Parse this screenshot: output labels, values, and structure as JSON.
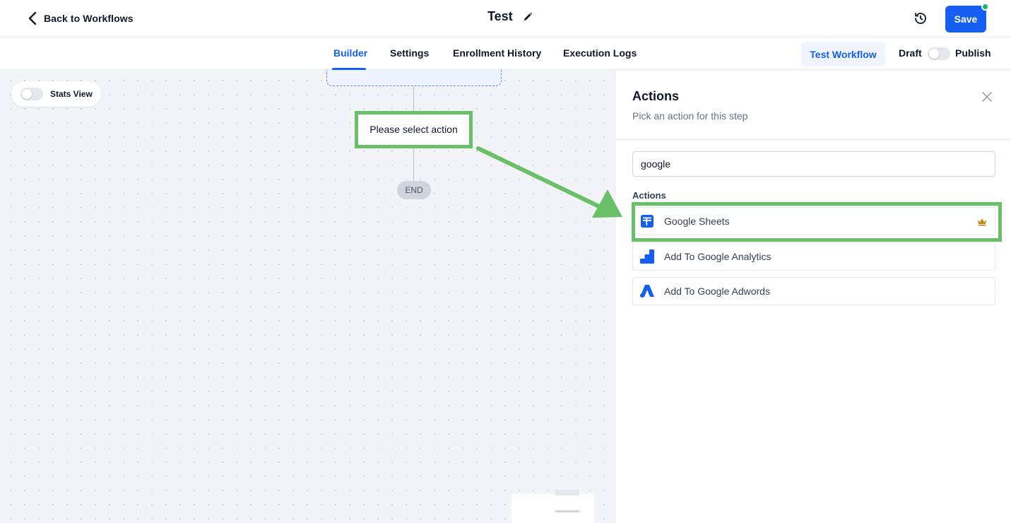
{
  "header": {
    "back_label": "Back to Workflows",
    "workflow_title": "Test",
    "save_label": "Save",
    "icons": {
      "back": "chevron-left-icon",
      "edit": "pencil-icon",
      "history": "history-clock-icon"
    },
    "status_dot_color": "#12b76a"
  },
  "tabs": [
    {
      "label": "Builder",
      "active": true
    },
    {
      "label": "Settings",
      "active": false
    },
    {
      "label": "Enrollment History",
      "active": false
    },
    {
      "label": "Execution Logs",
      "active": false
    }
  ],
  "toolbar": {
    "test_workflow_label": "Test Workflow",
    "draft_label": "Draft",
    "publish_label": "Publish",
    "publish_enabled": false
  },
  "canvas": {
    "stats_view_label": "Stats View",
    "stats_view_enabled": false,
    "action_node_label": "Please select action",
    "end_label": "END",
    "highlight_color": "#6abf69"
  },
  "panel": {
    "title": "Actions",
    "subtitle": "Pick an action for this step",
    "search_value": "google",
    "section_label": "Actions",
    "items": [
      {
        "label": "Google Sheets",
        "icon": "google-sheets-icon",
        "premium": true,
        "highlighted": true
      },
      {
        "label": "Add To Google Analytics",
        "icon": "google-analytics-icon",
        "premium": false,
        "highlighted": false
      },
      {
        "label": "Add To Google Adwords",
        "icon": "google-ads-icon",
        "premium": false,
        "highlighted": false
      }
    ]
  },
  "colors": {
    "accent": "#155eef",
    "accent_soft": "#eff4ff",
    "highlight": "#6abf69",
    "premium": "#c98a1b"
  }
}
